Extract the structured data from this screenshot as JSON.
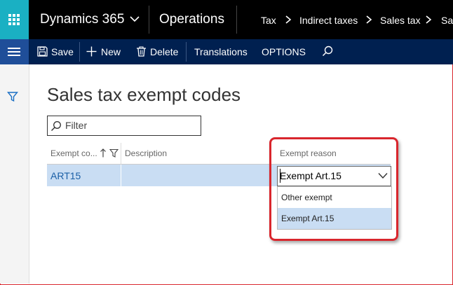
{
  "topbar": {
    "app_name": "Dynamics 365",
    "module": "Operations",
    "breadcrumb": [
      "Tax",
      "Indirect taxes",
      "Sales tax",
      "Sa"
    ]
  },
  "actions": {
    "save": "Save",
    "new": "New",
    "delete": "Delete",
    "translations": "Translations",
    "options": "OPTIONS"
  },
  "page": {
    "title": "Sales tax exempt codes",
    "filter_placeholder": "Filter"
  },
  "grid": {
    "columns": [
      "Exempt co...",
      "Description",
      "Exempt reason"
    ],
    "rows": [
      {
        "code": "ART15",
        "description": "",
        "reason": "Exempt Art.15"
      }
    ]
  },
  "dropdown": {
    "options": [
      "Other exempt",
      "Exempt Art.15"
    ],
    "selected": "Exempt Art.15"
  },
  "colors": {
    "topbar": "#000000",
    "waffle": "#1ab0c3",
    "actionbar": "#002050",
    "row_selected": "#c9ddf3",
    "highlight": "#d9262d"
  },
  "icons": [
    "app-launcher-icon",
    "chevron-down-icon",
    "chevron-right-icon",
    "hamburger-icon",
    "filter-funnel-icon",
    "save-icon",
    "plus-icon",
    "trash-icon",
    "search-icon",
    "sort-up-icon"
  ]
}
